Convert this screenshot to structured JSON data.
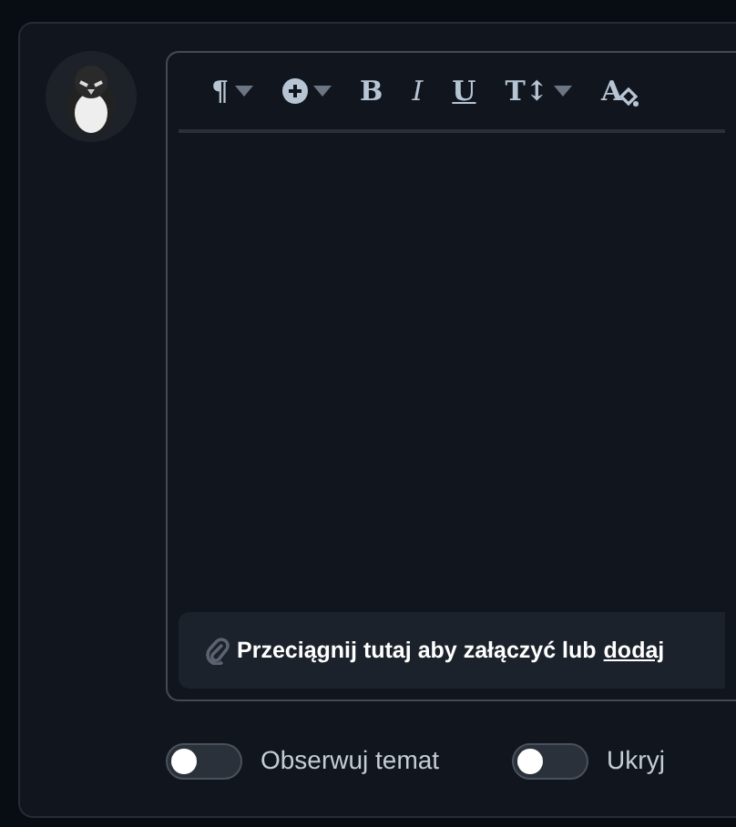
{
  "toolbar": [
    {
      "kind": "text",
      "label": "¶",
      "caret": true
    },
    {
      "kind": "plus",
      "caret": true
    },
    {
      "kind": "text",
      "label": "B",
      "caret": false
    },
    {
      "kind": "text",
      "label": "I",
      "caret": false
    },
    {
      "kind": "text",
      "label": "U",
      "caret": false
    },
    {
      "kind": "text",
      "label": "T↕",
      "caret": true
    },
    {
      "kind": "textcolor",
      "label": "A",
      "caret": false
    }
  ],
  "attachment": {
    "text": "Przeciągnij tutaj aby załączyć lub",
    "link": "dodaj"
  },
  "toggles": [
    {
      "label": "Obserwuj temat",
      "on": false
    },
    {
      "label": "Ukryj",
      "on": false
    }
  ]
}
